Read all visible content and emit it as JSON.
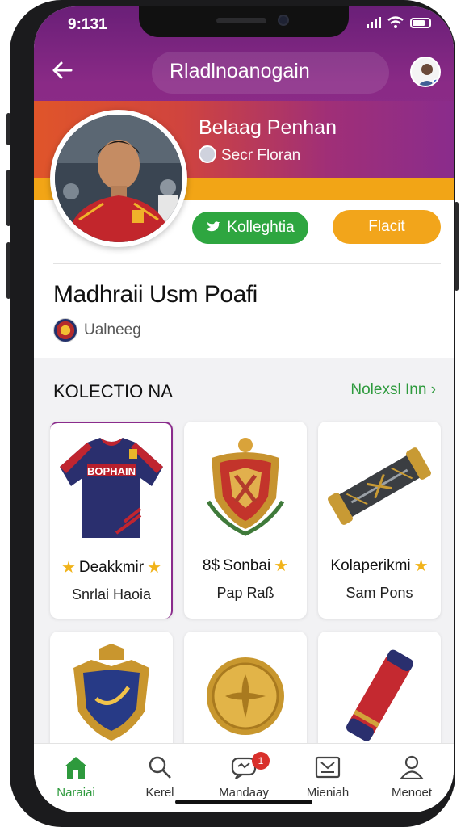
{
  "status_bar": {
    "time": "9:131"
  },
  "header": {
    "title": "Rladlnoanogain",
    "back_icon": "arrow-left-icon"
  },
  "profile": {
    "display_name": "Belaag Penhan",
    "handle": "Secr Floran",
    "follow_label": "Kolleghtia",
    "message_label": "Flacit",
    "full_name": "Madhraii Usm Poafi",
    "team": "Ualneeg"
  },
  "collection": {
    "title": "KOLECTIO NA",
    "see_all": "Nolexsl Inn",
    "items": [
      {
        "name": "Deakkmir",
        "subtitle": "Snrlai Haoia",
        "icon": "jersey-icon"
      },
      {
        "name": "Sonbai",
        "prefix": "8$",
        "subtitle": "Pap Raß",
        "icon": "shield-badge-icon"
      },
      {
        "name": "Kolaperikmi",
        "subtitle": "Sam Pons",
        "icon": "scroll-icon"
      },
      {
        "name": "",
        "subtitle": "",
        "icon": "crest-icon"
      },
      {
        "name": "",
        "subtitle": "",
        "icon": "gold-coin-icon"
      },
      {
        "name": "",
        "subtitle": "",
        "icon": "red-scroll-icon"
      }
    ]
  },
  "nav": {
    "items": [
      {
        "label": "Naraiai",
        "icon": "home-icon"
      },
      {
        "label": "Kerel",
        "icon": "search-icon"
      },
      {
        "label": "Mandaay",
        "icon": "chat-icon",
        "badge": "1"
      },
      {
        "label": "Mieniah",
        "icon": "inbox-icon"
      },
      {
        "label": "Menoet",
        "icon": "user-icon"
      }
    ]
  },
  "colors": {
    "purple": "#8a2c8c",
    "orange": "#f2a516",
    "green": "#2ea640"
  }
}
